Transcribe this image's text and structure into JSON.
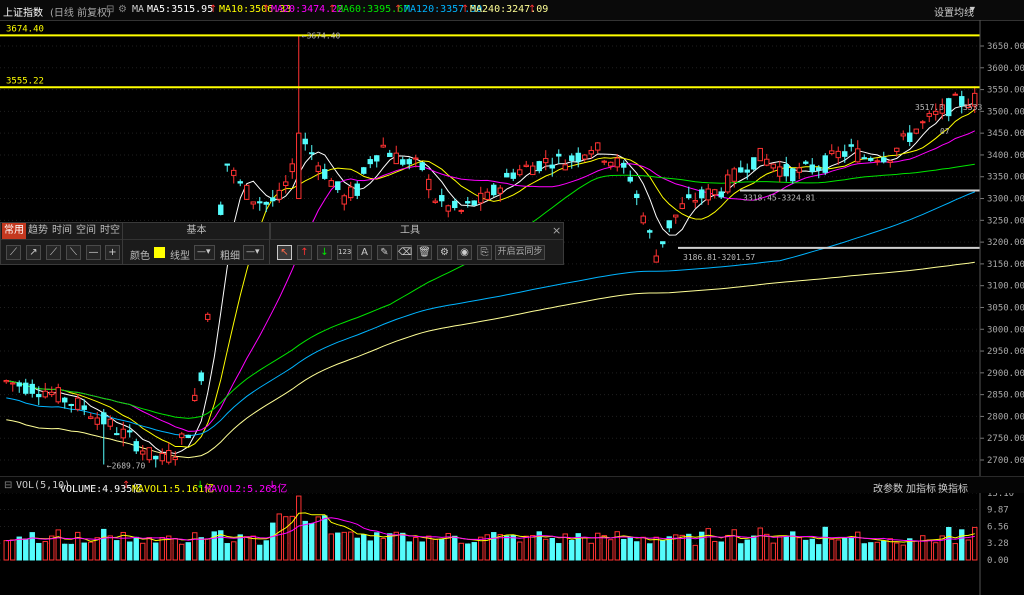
{
  "topbar": {
    "index_name": "上证指数",
    "period": "(日线 前复权)",
    "ma_prefix": "MA",
    "ma5": "MA5:3515.95",
    "ma10": "MA10:3506.33",
    "ma20": "MA20:3474.22",
    "ma60": "MA60:3395.67",
    "ma120": "MA120:3357.50",
    "ma240": "MA240:3247.09",
    "settings": "设置均线"
  },
  "annotations": {
    "hline_top": "3674.40",
    "hline_second": "3555.22",
    "high_label": "3674.40",
    "low_label": "2689.70",
    "seg_label_1": "3186.81-3201.57",
    "seg_label_2": "3318.45-3324.81",
    "right_label_a": "3517.3",
    "right_label_b": "3533",
    "right_label_c": "07"
  },
  "price_axis": [
    "3650.00",
    "3600.00",
    "3550.00",
    "3500.00",
    "3450.00",
    "3400.00",
    "3350.00",
    "3300.00",
    "3250.00",
    "3200.00",
    "3150.00",
    "3100.00",
    "3050.00",
    "3000.00",
    "2950.00",
    "2900.00",
    "2850.00",
    "2800.00",
    "2750.00",
    "2700.00"
  ],
  "volume_bar": {
    "indicator": "VOL(5,10)",
    "volume": "VOLUME:4.935亿",
    "mavol1": "MAVOL1:5.161亿",
    "mavol2": "MAVOL2:5.263亿",
    "btn_params": "改参数",
    "btn_add": "加指标",
    "btn_switch": "换指标"
  },
  "volume_axis": [
    "13.10",
    "9.87",
    "6.56",
    "3.28",
    "0.00"
  ],
  "toolpanel": {
    "tabs": [
      "常用",
      "趋势",
      "时间",
      "空间",
      "时空"
    ],
    "section_basic": "基本",
    "section_tools": "工具",
    "color_label": "颜色",
    "linetype_label": "线型",
    "thickness_label": "粗细",
    "sync_button": "开启云同步",
    "close_icon": "×"
  },
  "colors": {
    "up": "#ff3232",
    "down": "#54fcfc",
    "ma5": "#ffffff",
    "ma10": "#ffff00",
    "ma20": "#ff00ff",
    "ma60": "#00e600",
    "ma120": "#00b4ff",
    "ma240": "#ffff96",
    "hline": "#ffff00",
    "swatch": "#ffff00"
  },
  "chart_data": {
    "type": "candlestick",
    "y_range": [
      2680,
      3680
    ],
    "description_values": {
      "high": 3674.4,
      "low": 2689.7
    }
  }
}
